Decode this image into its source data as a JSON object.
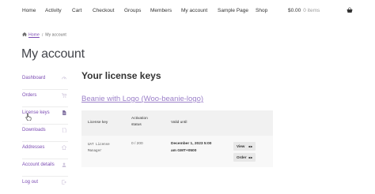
{
  "nav": {
    "items": [
      "Home",
      "Activity",
      "Cart",
      "Checkout",
      "Groups",
      "Members",
      "My account",
      "Sample Page",
      "Shop"
    ],
    "cart_total": "$0.00",
    "cart_items": "0 items",
    "basket_icon": "basket-icon"
  },
  "breadcrumb": {
    "home": "Home",
    "current": "My account"
  },
  "page_title": "My account",
  "sidebar": {
    "items": [
      {
        "label": "Dashboard",
        "icon": "dashboard-icon"
      },
      {
        "label": "Orders",
        "icon": "cart-icon"
      },
      {
        "label": "License keys",
        "icon": "file-icon"
      },
      {
        "label": "Downloads",
        "icon": "download-icon"
      },
      {
        "label": "Addresses",
        "icon": "home-icon"
      },
      {
        "label": "Account details",
        "icon": "user-icon"
      },
      {
        "label": "Log out",
        "icon": "logout-icon"
      }
    ],
    "link_color": "#7b4bb3"
  },
  "content": {
    "title": "Your license keys",
    "product_link": "Beanie with Logo (Woo-beanie-logo)",
    "table": {
      "headers": {
        "license_key": "License key",
        "activation_l1": "Activation",
        "activation_l2": "status",
        "valid_until": "Valid until"
      },
      "row": {
        "key_l1": "UAT License",
        "key_l2": "Manager",
        "activation": "0 / 200",
        "valid_l1": "December 1, 2023 5:00",
        "valid_l2": "am GMT+0500",
        "view_label": "View",
        "order_label": "Order"
      }
    }
  }
}
